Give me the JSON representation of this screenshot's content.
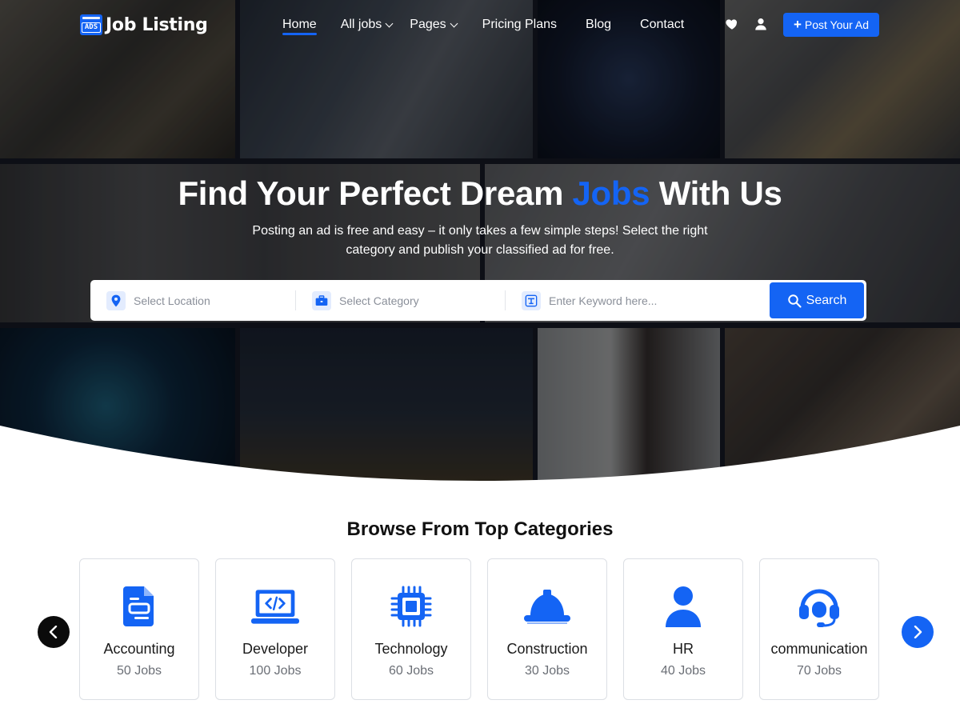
{
  "brand": {
    "name": "Job Listing",
    "badge": "ADS"
  },
  "nav": {
    "items": [
      {
        "label": "Home",
        "active": true,
        "dropdown": false
      },
      {
        "label": "All jobs",
        "active": false,
        "dropdown": true
      },
      {
        "label": "Pages",
        "active": false,
        "dropdown": true
      },
      {
        "label": "Pricing Plans",
        "active": false,
        "dropdown": false
      },
      {
        "label": "Blog",
        "active": false,
        "dropdown": false
      },
      {
        "label": "Contact",
        "active": false,
        "dropdown": false
      }
    ],
    "icons": [
      "heart-icon",
      "user-icon"
    ],
    "post_ad": "Post Your Ad"
  },
  "hero": {
    "title_before": "Find Your Perfect Dream",
    "title_accent": "Jobs",
    "title_after": "With Us",
    "subtitle": "Posting an ad is free and easy – it only takes a few simple steps! Select the right category and publish your classified ad for free."
  },
  "search": {
    "location_placeholder": "Select Location",
    "category_placeholder": "Select Category",
    "keyword_placeholder": "Enter Keyword here...",
    "button_label": "Search",
    "icons": [
      "location-pin-icon",
      "briefcase-icon",
      "keyword-icon",
      "search-icon"
    ]
  },
  "categories": {
    "title": "Browse From Top Categories",
    "items": [
      {
        "name": "Accounting",
        "count": "50 Jobs",
        "icon": "document-icon"
      },
      {
        "name": "Developer",
        "count": "100 Jobs",
        "icon": "laptop-code-icon"
      },
      {
        "name": "Technology",
        "count": "60 Jobs",
        "icon": "microchip-icon"
      },
      {
        "name": "Construction",
        "count": "30 Jobs",
        "icon": "hard-hat-icon"
      },
      {
        "name": "HR",
        "count": "40 Jobs",
        "icon": "person-icon"
      },
      {
        "name": "communication",
        "count": "70 Jobs",
        "icon": "headset-icon"
      }
    ],
    "prev_icon": "chevron-left-icon",
    "next_icon": "chevron-right-icon"
  },
  "colors": {
    "accent": "#1464f4",
    "text_dark": "#111111",
    "text_muted": "#6b6f76",
    "card_border": "#dcdfe4"
  }
}
